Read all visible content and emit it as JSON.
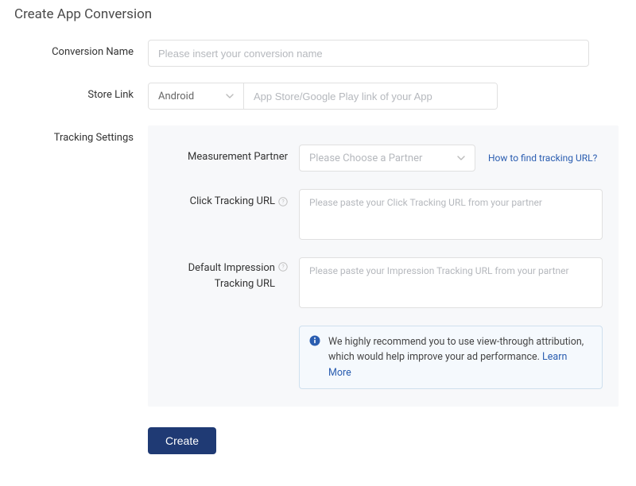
{
  "title": "Create App Conversion",
  "fields": {
    "conversion_name": {
      "label": "Conversion Name",
      "placeholder": "Please insert your conversion name"
    },
    "store_link": {
      "label": "Store Link",
      "platform_value": "Android",
      "url_placeholder": "App Store/Google Play link of your App"
    }
  },
  "tracking": {
    "label": "Tracking Settings",
    "partner": {
      "label": "Measurement Partner",
      "placeholder": "Please Choose a Partner",
      "help_link": "How to find tracking URL?"
    },
    "click_url": {
      "label": "Click Tracking URL",
      "placeholder": "Please paste your Click Tracking URL from your partner"
    },
    "impression_url": {
      "label_line1": "Default Impression",
      "label_line2": "Tracking URL",
      "placeholder": "Please paste your Impression Tracking URL from your partner"
    },
    "info": {
      "text": "We highly recommend you to use view-through attribution, which would help improve your ad performance. ",
      "link": "Learn More"
    }
  },
  "submit_label": "Create"
}
